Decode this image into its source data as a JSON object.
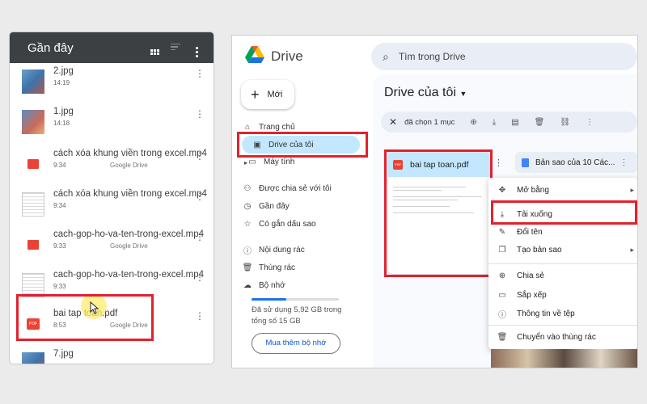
{
  "phone": {
    "title": "Gần đây",
    "files": [
      {
        "name": "2.jpg",
        "meta": "14:19",
        "source": "",
        "kind": "img"
      },
      {
        "name": "1.jpg",
        "meta": "14:18",
        "source": "",
        "kind": "img2"
      },
      {
        "name": "cách xóa khung viền trong excel.mp4",
        "meta": "9:34",
        "source": "Google Drive",
        "kind": "vid"
      },
      {
        "name": "cách xóa khung viền trong excel.mp4",
        "meta": "9:34",
        "source": "",
        "kind": "sheet"
      },
      {
        "name": "cach-gop-ho-va-ten-trong-excel.mp4",
        "meta": "9:33",
        "source": "Google Drive",
        "kind": "vid"
      },
      {
        "name": "cach-gop-ho-va-ten-trong-excel.mp4",
        "meta": "9:33",
        "source": "",
        "kind": "sheet"
      },
      {
        "name": "bai tap toan.pdf",
        "meta": "8:53",
        "source": "Google Drive",
        "kind": "pdf"
      },
      {
        "name": "7.jpg",
        "meta": "",
        "source": "",
        "kind": "img"
      }
    ]
  },
  "drive": {
    "brand": "Drive",
    "search_placeholder": "Tìm trong Drive",
    "new_label": "Mới",
    "nav": {
      "home": "Trang chủ",
      "my_drive": "Drive của tôi",
      "computers": "Máy tính",
      "shared": "Được chia sẻ với tôi",
      "recent": "Gần đây",
      "starred": "Có gắn dấu sao",
      "spam": "Nội dung rác",
      "trash": "Thùng rác",
      "storage": "Bộ nhớ"
    },
    "storage_text": "Đã sử dụng 5,92 GB trong tổng số 15 GB",
    "buy_storage": "Mua thêm bộ nhớ",
    "page_title": "Drive của tôi",
    "selection_text": "đã chọn 1 mục",
    "selected_file": "bai tap toan.pdf",
    "other_file": "Bản sao của 10 Các...",
    "context_menu": {
      "open_with": "Mở bằng",
      "download": "Tải xuống",
      "rename": "Đổi tên",
      "copy": "Tạo bản sao",
      "share": "Chia sẻ",
      "organize": "Sắp xếp",
      "file_info": "Thông tin về tệp",
      "move_to_trash": "Chuyển vào thùng rác"
    }
  },
  "colors": {
    "highlight": "#e0222f",
    "drive_active": "#c2e7ff",
    "phone_bar": "#3c4043"
  }
}
